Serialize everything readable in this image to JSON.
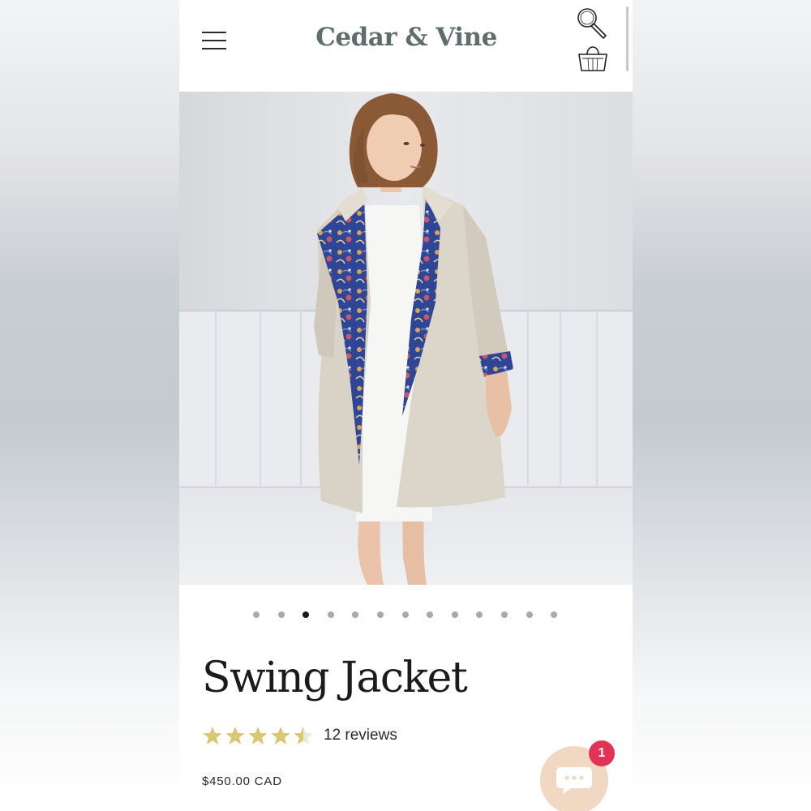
{
  "header": {
    "brand": "Cedar & Vine",
    "menu_icon": "hamburger-menu-icon",
    "search_icon": "search-icon",
    "cart_icon": "shopping-bag-icon"
  },
  "product": {
    "title": "Swing Jacket",
    "rating": 4.5,
    "rating_max": 5,
    "reviews_label": "12 reviews",
    "price": "$450.00 CAD",
    "image_alt": "Model wearing a beige swing jacket with blue floral-lined lapels over a white dress"
  },
  "carousel": {
    "total": 13,
    "active_index": 2
  },
  "chat": {
    "icon": "chat-bubble-icon",
    "badge_count": "1"
  },
  "colors": {
    "brand": "#5e6e6b",
    "star": "#d9c772",
    "chat_bg": "#f1d8c3",
    "badge": "#e23256"
  }
}
